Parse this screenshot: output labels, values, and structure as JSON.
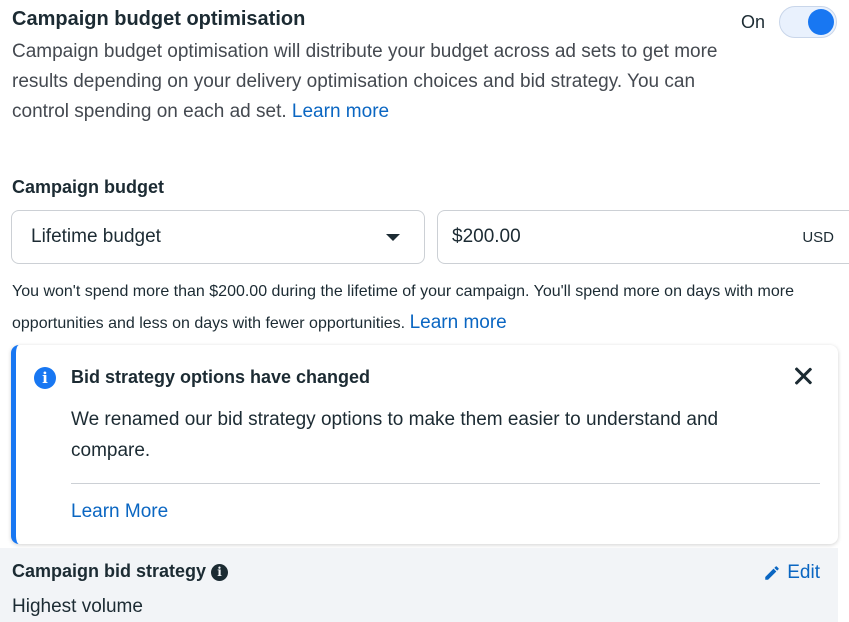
{
  "cbo": {
    "title": "Campaign budget optimisation",
    "toggle_label": "On",
    "toggle_state": "on",
    "description": "Campaign budget optimisation will distribute your budget across ad sets to get more results depending on your delivery optimisation choices and bid strategy. You can control spending on each ad set.",
    "learn_more": "Learn more"
  },
  "campaign_budget": {
    "label": "Campaign budget",
    "budget_type": "Lifetime budget",
    "amount": "$200.00",
    "currency": "USD",
    "note": "You won't spend more than $200.00 during the lifetime of your campaign. You'll spend more on days with more opportunities and less on days with fewer opportunities.",
    "learn_more": "Learn more"
  },
  "notice": {
    "icon": "info-icon",
    "title": "Bid strategy options have changed",
    "body": "We renamed our bid strategy options to make them easier to understand and compare.",
    "learn_more": "Learn More"
  },
  "bid_strategy": {
    "title": "Campaign bid strategy",
    "value": "Highest volume",
    "edit_label": "Edit"
  },
  "colors": {
    "accent": "#1877f2",
    "link": "#0a66c2",
    "text": "#1c2b33"
  }
}
